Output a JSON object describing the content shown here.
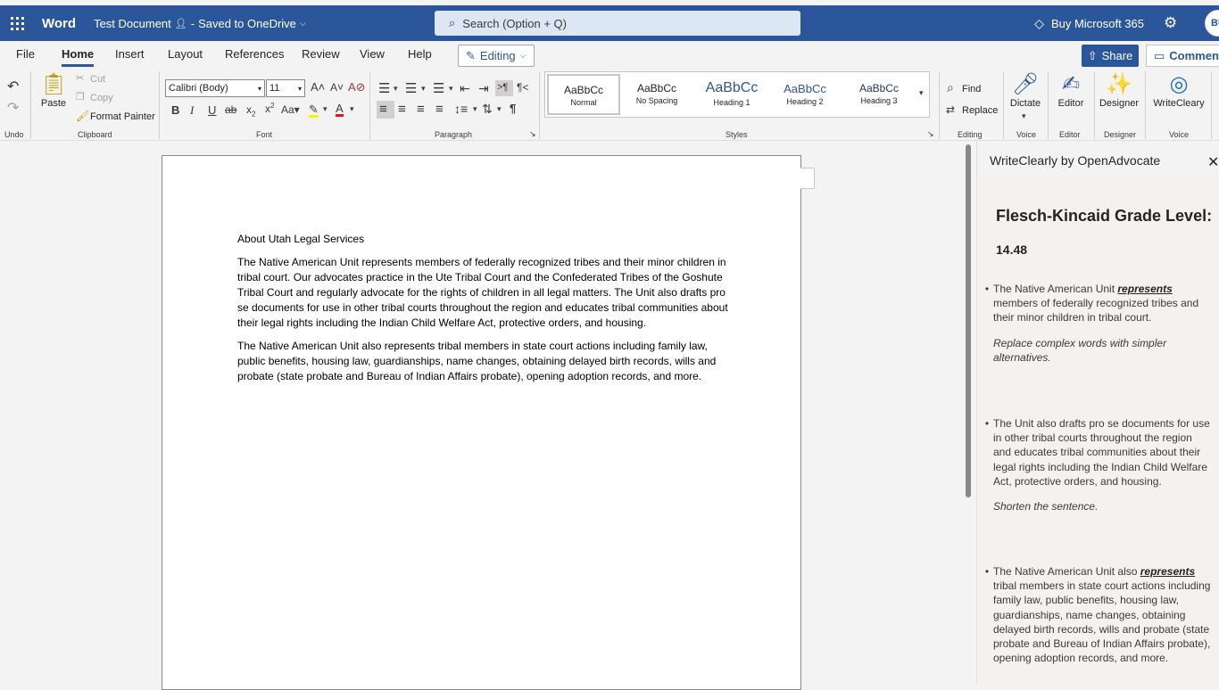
{
  "titlebar": {
    "app_name": "Word",
    "doc_title": "Test Document",
    "save_status": "Saved to OneDrive",
    "search_placeholder": "Search (Option + Q)",
    "buy_label": "Buy Microsoft 365",
    "avatar_initials": "BU"
  },
  "tabs": [
    "File",
    "Home",
    "Insert",
    "Layout",
    "References",
    "Review",
    "View",
    "Help"
  ],
  "active_tab": "Home",
  "editing_label": "Editing",
  "share_label": "Share",
  "comments_label": "Comments",
  "ribbon": {
    "undo_group": "Undo",
    "paste_label": "Paste",
    "cut_label": "Cut",
    "copy_label": "Copy",
    "format_painter_label": "Format Painter",
    "clipboard_group": "Clipboard",
    "font_name": "Calibri (Body)",
    "font_size": "11",
    "font_group": "Font",
    "paragraph_group": "Paragraph",
    "styles": [
      {
        "preview": "AaBbCc",
        "name": "Normal"
      },
      {
        "preview": "AaBbCc",
        "name": "No Spacing"
      },
      {
        "preview": "AaBbCc",
        "name": "Heading 1"
      },
      {
        "preview": "AaBbCc",
        "name": "Heading 2"
      },
      {
        "preview": "AaBbCc",
        "name": "Heading 3"
      }
    ],
    "styles_group": "Styles",
    "find_label": "Find",
    "replace_label": "Replace",
    "editing_group": "Editing",
    "dictate_label": "Dictate",
    "voice_group": "Voice",
    "editor_label": "Editor",
    "editor_group": "Editor",
    "designer_label": "Designer",
    "designer_group": "Designer",
    "writecleary_label": "WriteCleary",
    "voice_group2": "Voice"
  },
  "document": {
    "heading": "About Utah Legal Services",
    "para1": "The Native American Unit represents members of federally recognized tribes and their minor children in tribal court. Our advocates practice in the Ute Tribal Court and the Confederated Tribes of the Goshute Tribal Court and regularly advocate for the rights of children in all legal matters. The Unit also drafts pro se documents for use in other tribal courts throughout the region and educates tribal communities about their legal rights including the Indian Child Welfare Act, protective orders, and housing.",
    "para2": "The Native American Unit also represents tribal members in state court actions including family law, public benefits, housing law, guardianships, name changes, obtaining delayed birth records, wills and probate (state probate and Bureau of Indian Affairs probate), opening adoption records, and more."
  },
  "pane": {
    "title": "WriteClearly by OpenAdvocate",
    "fk_heading": "Flesch-Kincaid Grade Level:",
    "fk_score": "14.48",
    "suggestions": [
      {
        "before": "The Native American Unit ",
        "word": "represents",
        "after": " members of federally recognized tribes and their minor children in tribal court.",
        "advice": "Replace complex words with simpler alternatives."
      },
      {
        "before": "The Unit also drafts pro se documents for use in other tribal courts throughout the region and educates tribal communities about their legal rights including the Indian Child Welfare Act, protective orders, and housing.",
        "word": "",
        "after": "",
        "advice": "Shorten the sentence."
      },
      {
        "before": "The Native American Unit also ",
        "word": "represents",
        "after": " tribal members in state court actions including family law, public benefits, housing law, guardianships, name changes, obtaining delayed birth records, wills and probate (state probate and Bureau of Indian Affairs probate), opening adoption records, and more.",
        "advice": ""
      }
    ]
  }
}
